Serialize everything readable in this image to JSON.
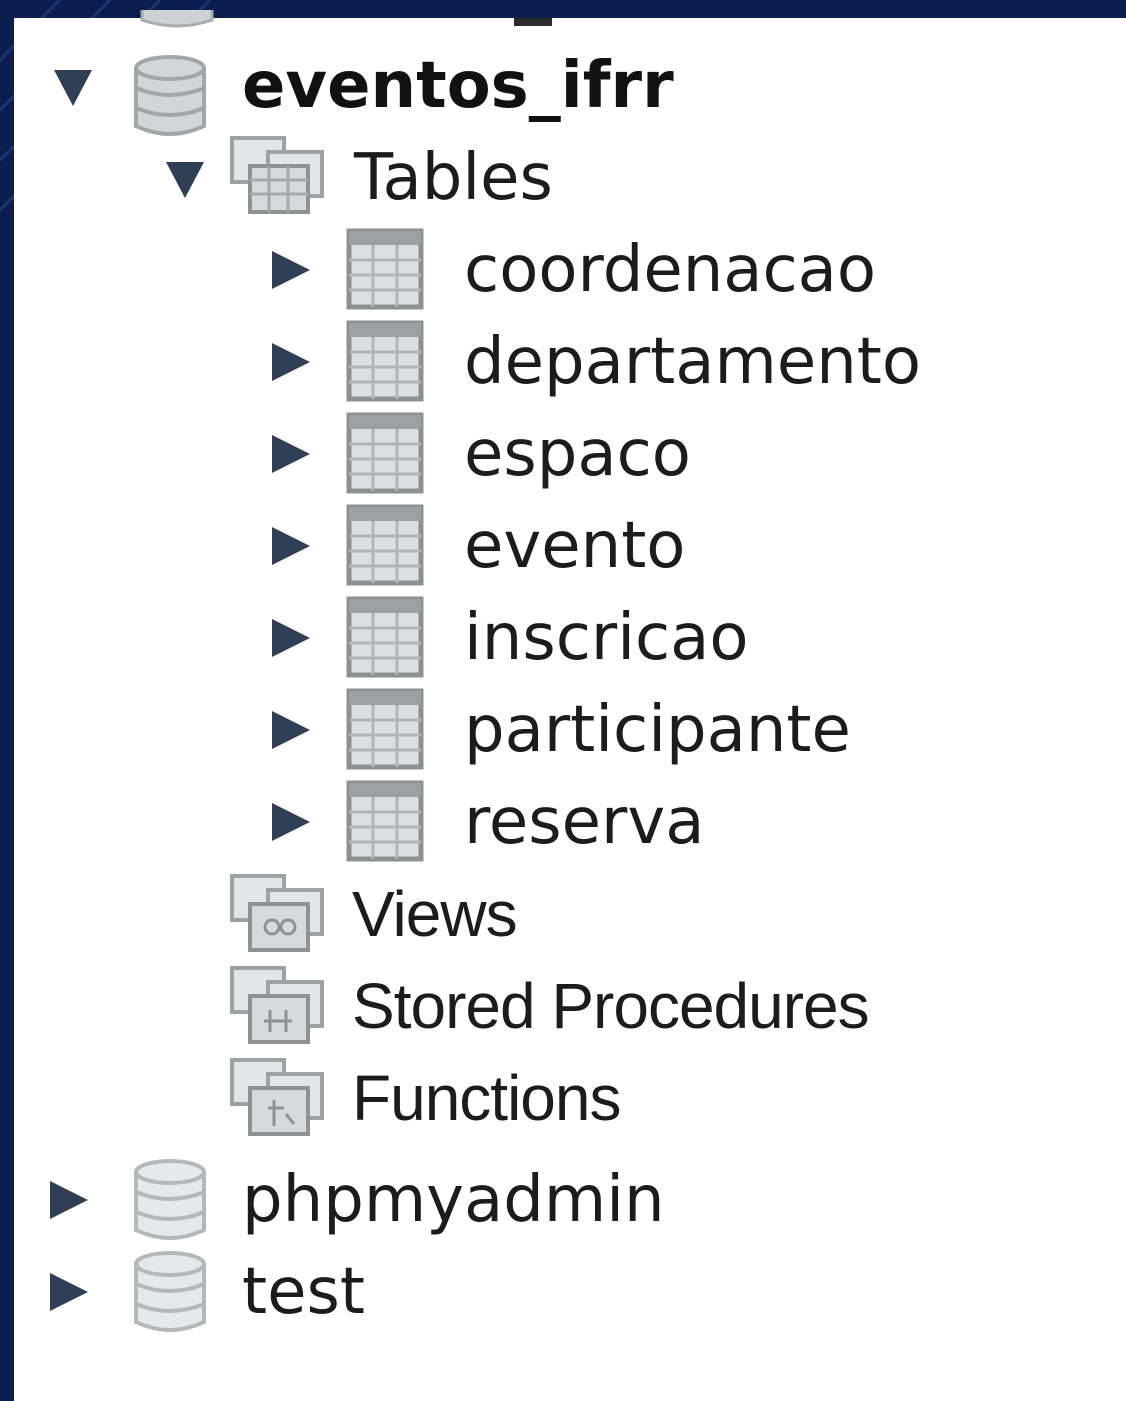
{
  "tree": {
    "database_eventos": {
      "label": "eventos_ifrr",
      "icon": "database-icon",
      "expanded": true
    },
    "tables_folder": {
      "label": "Tables",
      "icon": "tables-folder-icon",
      "expanded": true
    },
    "tables": [
      {
        "label": "coordenacao",
        "icon": "table-icon"
      },
      {
        "label": "departamento",
        "icon": "table-icon"
      },
      {
        "label": "espaco",
        "icon": "table-icon"
      },
      {
        "label": "evento",
        "icon": "table-icon"
      },
      {
        "label": "inscricao",
        "icon": "table-icon"
      },
      {
        "label": "participante",
        "icon": "table-icon"
      },
      {
        "label": "reserva",
        "icon": "table-icon"
      }
    ],
    "views_folder": {
      "label": "Views",
      "icon": "views-folder-icon"
    },
    "procedures_folder": {
      "label": "Stored Procedures",
      "icon": "procedures-folder-icon"
    },
    "functions_folder": {
      "label": "Functions",
      "icon": "functions-folder-icon"
    },
    "database_phpmyadmin": {
      "label": "phpmyadmin",
      "icon": "database-icon",
      "expanded": false
    },
    "database_test": {
      "label": "test",
      "icon": "database-icon",
      "expanded": false
    }
  },
  "colors": {
    "frame": "#0b1d4d",
    "panel": "#ffffff",
    "arrow": "#2f3f55",
    "icon_gray": "#b9bcbf"
  }
}
